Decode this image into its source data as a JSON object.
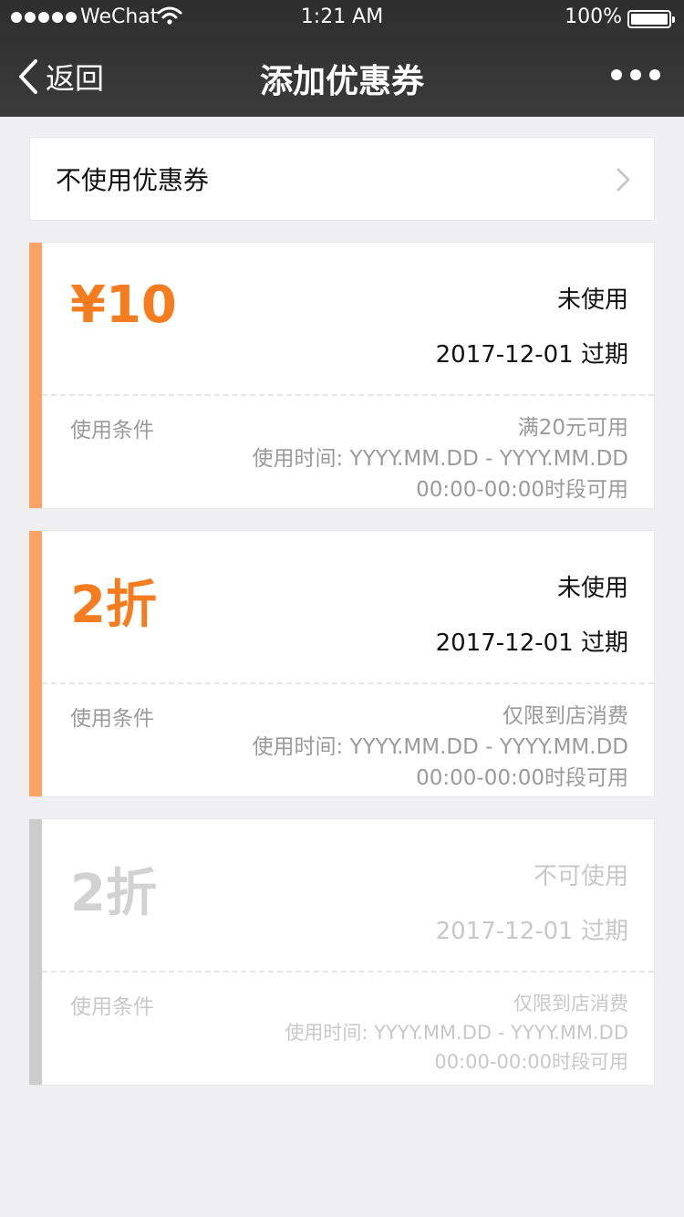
{
  "status_bar": {
    "carrier": "WeChat",
    "time": "1:21 AM",
    "battery": "100%"
  },
  "nav": {
    "back_label": "返回",
    "title": "添加优惠券"
  },
  "no_coupon": {
    "label": "不使用优惠券"
  },
  "coupons": [
    {
      "amount": "¥10",
      "state": "未使用",
      "expire": "2017-12-01 过期",
      "condition_label": "使用条件",
      "condition": "满20元可用",
      "use_time": "使用时间: YYYY.MM.DD - YYYY.MM.DD",
      "time_slot": "00:00-00:00时段可用",
      "status": "active"
    },
    {
      "amount": "2折",
      "state": "未使用",
      "expire": "2017-12-01 过期",
      "condition_label": "使用条件",
      "condition": "仅限到店消费",
      "use_time": "使用时间: YYYY.MM.DD - YYYY.MM.DD",
      "time_slot": "00:00-00:00时段可用",
      "status": "active"
    },
    {
      "amount": "2折",
      "state": "不可使用",
      "expire": "2017-12-01 过期",
      "condition_label": "使用条件",
      "condition": "仅限到店消费",
      "use_time": "使用时间: YYYY.MM.DD - YYYY.MM.DD",
      "time_slot": "00:00-00:00时段可用",
      "status": "disabled"
    }
  ],
  "colors": {
    "accent": "#f57c1f",
    "accent_bar": "#fba466",
    "disabled": "#cccccc",
    "nav_bg": "#333333"
  },
  "icons": {
    "back": "chevron-left-icon",
    "more": "more-dots-icon",
    "arrow": "chevron-right-icon",
    "wifi": "wifi-icon",
    "battery": "battery-icon",
    "signal": "signal-dots-icon"
  }
}
